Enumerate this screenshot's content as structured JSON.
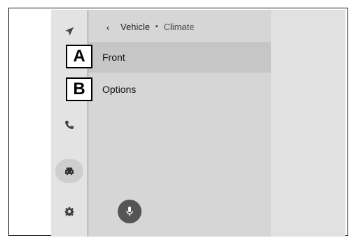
{
  "breadcrumb": {
    "parent": "Vehicle",
    "separator": "•",
    "current": "Climate"
  },
  "menu": [
    {
      "label": "Front",
      "selected": true
    },
    {
      "label": "Options",
      "selected": false
    }
  ],
  "callouts": [
    "A",
    "B"
  ],
  "sidebar_icons": [
    "navigation-icon",
    "phone-icon",
    "car-icon",
    "gear-icon"
  ],
  "colors": {
    "screen_bg": "#dcdcdc",
    "selected_row": "#c6c6c6",
    "mic_button": "#555555"
  }
}
